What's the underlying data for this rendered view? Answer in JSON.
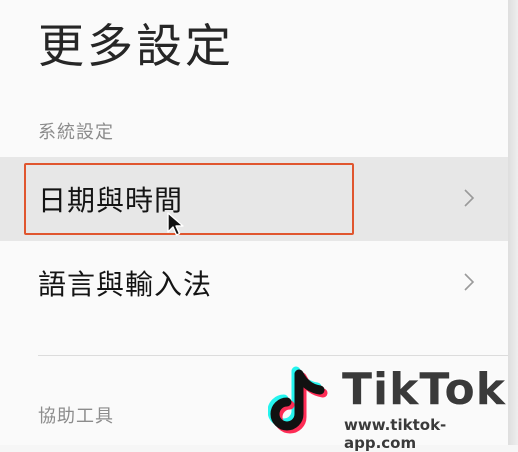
{
  "page_title": "更多設定",
  "sections": [
    {
      "header": "系統設定",
      "items": [
        {
          "label": "日期與時間",
          "icon": "chevron-right-icon"
        },
        {
          "label": "語言與輸入法",
          "icon": "chevron-right-icon"
        }
      ]
    },
    {
      "header": "協助工具"
    }
  ],
  "watermark": {
    "brand": "TikTok",
    "url": "www.tiktok-app.com"
  },
  "colors": {
    "highlight_border": "#e0562f",
    "highlight_row": "#e7e7e7",
    "accent_cyan": "#25f4ee",
    "accent_red": "#fe2c55"
  }
}
